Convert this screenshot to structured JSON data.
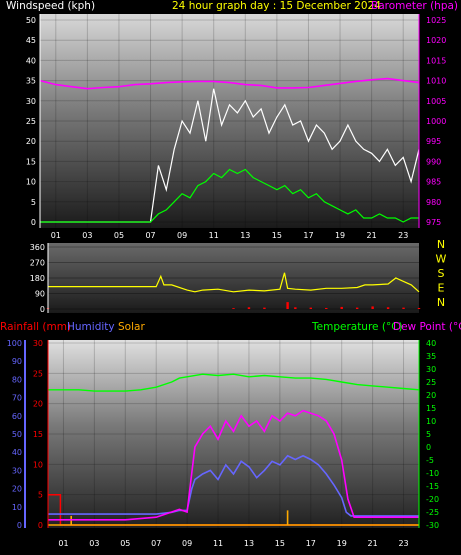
{
  "titles": {
    "wind": "Windspeed (kph)",
    "center": "24 hour graph day : 15 December 2024",
    "baro": "Barometer (hpa)",
    "rain": "Rainfall (mm)",
    "humidity": "Humidity",
    "solar": "Solar",
    "temp": "Temperature (°C)",
    "dew": "Dew Point (°C)"
  },
  "colors": {
    "wind_title": "#ffffff",
    "center_title": "#ffff00",
    "baro": "#ff00ff",
    "wind_speed": "#ffffff",
    "wind_avg": "#00ff00",
    "direction": "#ffff00",
    "dir_rain_bar": "#ff0000",
    "rain": "#ff0000",
    "humidity": "#6666ff",
    "solar": "#ffaa00",
    "temp": "#00ff00",
    "dew": "#ff00ff",
    "axis_left": "#6666ff",
    "axis_right": "#00ff00",
    "x_tick": "#ffffff"
  },
  "compass": [
    "N",
    "W",
    "S",
    "E",
    "N"
  ],
  "chart_data": [
    {
      "type": "line",
      "name": "wind-and-barometer",
      "x_ticks": [
        "01",
        "03",
        "05",
        "07",
        "09",
        "11",
        "13",
        "15",
        "17",
        "19",
        "21",
        "23"
      ],
      "y_left_ticks": [
        "0",
        "5",
        "10",
        "15",
        "20",
        "25",
        "30",
        "35",
        "40",
        "45",
        "50"
      ],
      "y_left_range": [
        0,
        50
      ],
      "y_right_ticks": [
        "975",
        "980",
        "985",
        "990",
        "995",
        "1000",
        "1005",
        "1010",
        "1015",
        "1020",
        "1025"
      ],
      "y_right_range": [
        975,
        1025
      ],
      "x_range": [
        0,
        24
      ],
      "series": [
        {
          "name": "Windspeed (kph)",
          "x": [
            0,
            7,
            7.5,
            8,
            8.5,
            9,
            9.5,
            10,
            10.5,
            11,
            11.5,
            12,
            12.5,
            13,
            13.5,
            14,
            14.5,
            15,
            15.5,
            16,
            16.5,
            17,
            17.5,
            18,
            18.5,
            19,
            19.5,
            20,
            20.5,
            21,
            21.5,
            22,
            22.5,
            23,
            23.5,
            24
          ],
          "y": [
            0,
            0,
            14,
            8,
            18,
            25,
            22,
            30,
            20,
            33,
            24,
            29,
            27,
            30,
            26,
            28,
            22,
            26,
            29,
            24,
            25,
            20,
            24,
            22,
            18,
            20,
            24,
            20,
            18,
            17,
            15,
            18,
            14,
            16,
            10,
            18
          ]
        },
        {
          "name": "Wind average",
          "x": [
            0,
            7,
            7.5,
            8,
            8.5,
            9,
            9.5,
            10,
            10.5,
            11,
            11.5,
            12,
            12.5,
            13,
            13.5,
            14,
            14.5,
            15,
            15.5,
            16,
            16.5,
            17,
            17.5,
            18,
            18.5,
            19,
            19.5,
            20,
            20.5,
            21,
            21.5,
            22,
            22.5,
            23,
            23.5,
            24
          ],
          "y": [
            0,
            0,
            2,
            3,
            5,
            7,
            6,
            9,
            10,
            12,
            11,
            13,
            12,
            13,
            11,
            10,
            9,
            8,
            9,
            7,
            8,
            6,
            7,
            5,
            4,
            3,
            2,
            3,
            1,
            1,
            2,
            1,
            1,
            0,
            1,
            1
          ]
        },
        {
          "name": "Barometer (hpa)",
          "x": [
            0,
            1,
            2,
            3,
            4,
            5,
            6,
            7,
            8,
            9,
            10,
            11,
            12,
            13,
            14,
            15,
            16,
            17,
            18,
            19,
            20,
            21,
            22,
            23,
            24
          ],
          "y": [
            1010,
            1009,
            1008.5,
            1008,
            1008.3,
            1008.5,
            1009,
            1009.2,
            1009.5,
            1009.7,
            1009.8,
            1009.8,
            1009.5,
            1009,
            1008.8,
            1008.2,
            1008.2,
            1008.3,
            1008.8,
            1009.3,
            1009.8,
            1010.2,
            1010.5,
            1010,
            1009.5
          ]
        }
      ]
    },
    {
      "type": "line",
      "name": "wind-direction",
      "x_range": [
        0,
        24
      ],
      "y_left_ticks": [
        "0",
        "90",
        "180",
        "270",
        "360"
      ],
      "y_range": [
        0,
        360
      ],
      "series": [
        {
          "name": "Wind direction",
          "x": [
            0,
            7,
            7.3,
            7.5,
            8,
            9,
            9.5,
            10,
            11,
            12,
            13,
            14,
            15,
            15.3,
            15.5,
            16,
            17,
            18,
            19,
            20,
            20.5,
            21,
            22,
            22.5,
            23,
            23.5,
            24
          ],
          "y": [
            130,
            130,
            190,
            140,
            140,
            110,
            100,
            110,
            115,
            100,
            110,
            105,
            115,
            210,
            120,
            115,
            110,
            120,
            120,
            125,
            140,
            140,
            145,
            180,
            160,
            140,
            100
          ]
        },
        {
          "name": "Rain bars",
          "x": [
            0,
            12,
            13,
            14,
            15.5,
            16,
            17,
            18,
            19,
            20,
            21,
            22,
            23,
            24
          ],
          "y": [
            5,
            5,
            10,
            8,
            40,
            10,
            8,
            6,
            12,
            8,
            15,
            10,
            8,
            6
          ]
        }
      ]
    },
    {
      "type": "line",
      "name": "rain-humidity-solar-temperature",
      "x_ticks": [
        "01",
        "03",
        "05",
        "07",
        "09",
        "11",
        "13",
        "15",
        "17",
        "19",
        "21",
        "23"
      ],
      "x_range": [
        0,
        24
      ],
      "y_outer_left_ticks": [
        "0",
        "10",
        "20",
        "30",
        "40",
        "50",
        "60",
        "70",
        "80",
        "90",
        "100"
      ],
      "y_outer_left_range": [
        0,
        100
      ],
      "y_inner_left_ticks": [
        "0",
        "5",
        "10",
        "15",
        "20",
        "25",
        "30"
      ],
      "y_inner_left_range": [
        0,
        30
      ],
      "y_right_ticks": [
        "-30",
        "-25",
        "-20",
        "-15",
        "-10",
        "-5",
        "0",
        "5",
        "10",
        "15",
        "20",
        "25",
        "30",
        "35",
        "40"
      ],
      "y_right_range": [
        -30,
        40
      ],
      "series": [
        {
          "name": "Rainfall (mm)",
          "x": [
            0,
            0.8,
            0.8,
            24
          ],
          "y": [
            5,
            5,
            0,
            0
          ]
        },
        {
          "name": "Humidity",
          "x": [
            0,
            1,
            3,
            5,
            7,
            8,
            8.5,
            9,
            9.3,
            9.5,
            10,
            10.5,
            11,
            11.5,
            12,
            12.5,
            13,
            13.5,
            14,
            14.5,
            15,
            15.5,
            16,
            16.5,
            17,
            17.5,
            18,
            18.5,
            19,
            19.3,
            19.6,
            20,
            21,
            22,
            23,
            24
          ],
          "y": [
            6,
            6,
            6,
            6,
            6,
            7,
            8,
            8,
            20,
            25,
            28,
            30,
            25,
            33,
            28,
            35,
            32,
            26,
            30,
            35,
            33,
            38,
            36,
            38,
            36,
            33,
            28,
            22,
            15,
            7,
            5,
            5,
            5,
            5,
            5,
            5
          ]
        },
        {
          "name": "Solar",
          "x": [
            0,
            1.5,
            1.5,
            1.5,
            15.5,
            15.5,
            15.5,
            24
          ],
          "y": [
            0,
            0,
            5,
            0,
            0,
            8,
            0,
            0
          ]
        },
        {
          "name": "Temperature (°C)",
          "x": [
            0,
            1,
            2,
            3,
            4,
            5,
            6,
            7,
            8,
            8.5,
            9,
            10,
            11,
            12,
            13,
            14,
            15,
            16,
            17,
            18,
            19,
            20,
            21,
            22,
            23,
            24
          ],
          "y": [
            22,
            22,
            22,
            21.5,
            21.5,
            21.5,
            22,
            23,
            25,
            26.5,
            27,
            28,
            27.5,
            28,
            27,
            27.5,
            27,
            26.5,
            26.5,
            26,
            25,
            24,
            23.5,
            23,
            22.5,
            22
          ]
        },
        {
          "name": "Dew Point (°C)",
          "x": [
            0,
            1,
            3,
            5,
            7,
            8,
            8.5,
            9,
            9.5,
            10,
            10.5,
            11,
            11.5,
            12,
            12.5,
            13,
            13.5,
            14,
            14.5,
            15,
            15.5,
            16,
            16.5,
            17,
            17.5,
            18,
            18.5,
            19,
            19.4,
            19.8,
            20,
            21,
            22,
            23,
            24
          ],
          "y": [
            -28,
            -28,
            -28,
            -28,
            -27,
            -25,
            -24,
            -25,
            0,
            5,
            8,
            3,
            10,
            6,
            12,
            8,
            10,
            6,
            12,
            10,
            13,
            12,
            14,
            13,
            12,
            10,
            5,
            -5,
            -20,
            -27,
            -27,
            -27,
            -27,
            -27,
            -27
          ]
        }
      ]
    }
  ]
}
